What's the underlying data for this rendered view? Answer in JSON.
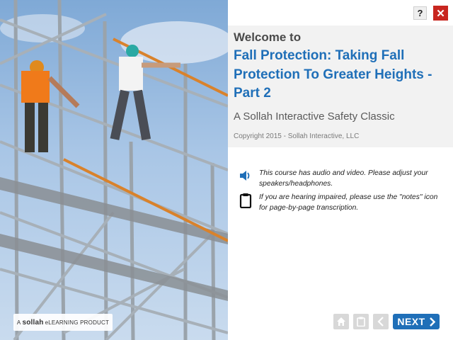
{
  "header": {
    "help_label": "?",
    "close_label": "✕",
    "help_icon": "question-icon",
    "close_icon": "close-icon"
  },
  "intro": {
    "welcome": "Welcome to",
    "title": "Fall Protection: Taking Fall Protection To Greater Heights - Part 2",
    "subtitle": "A Sollah Interactive Safety Classic",
    "copyright": "Copyright 2015 - Sollah Interactive, LLC"
  },
  "notices": [
    {
      "icon": "speaker-icon",
      "text": "This course has audio and video. Please adjust your speakers/headphones."
    },
    {
      "icon": "clipboard-icon",
      "text": "If you are hearing impaired, please use the \"notes\" icon for page-by-page transcription."
    }
  ],
  "brand": {
    "prefix": "A",
    "name": "sollah",
    "suffix": "eLEARNING PRODUCT"
  },
  "nav": {
    "home_icon": "home-icon",
    "notes_icon": "clipboard-icon",
    "back_icon": "chevron-left-icon",
    "next_label": "NEXT",
    "next_icon": "chevron-right-icon"
  },
  "colors": {
    "accent": "#1f6fb8",
    "close": "#c8261f",
    "title_box": "#f2f2f2",
    "nav_disabled": "#d8d8d8"
  }
}
